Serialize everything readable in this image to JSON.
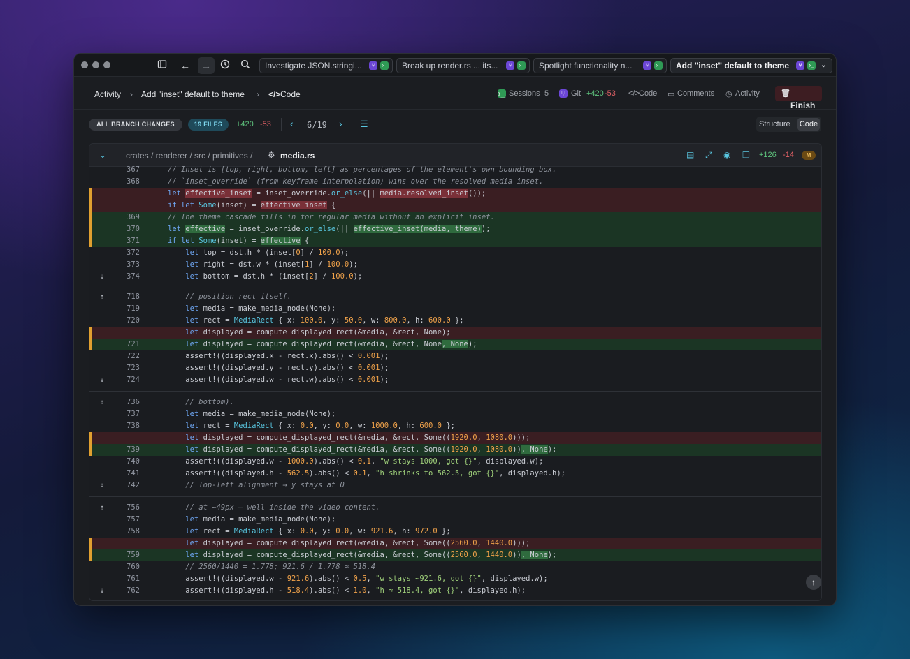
{
  "titlebar": {
    "tabs": [
      "Investigate JSON.stringi...",
      "Break up render.rs ... its...",
      "Spotlight functionality n...",
      "Add \"inset\" default to theme"
    ]
  },
  "header": {
    "crumb1": "Activity",
    "crumb2": "Add \"inset\" default to theme",
    "crumb3": "Code",
    "sessions_label": "Sessions",
    "sessions_count": "5",
    "git_label": "Git",
    "git_add": "+420",
    "git_del": "-53",
    "code_label": "Code",
    "comments_label": "Comments",
    "activity_label": "Activity",
    "finish_label": "Finish"
  },
  "changes": {
    "all_label": "ALL BRANCH CHANGES",
    "files_label": "19 FILES",
    "add": "+420",
    "del": "-53",
    "pager": "6/19",
    "structure_label": "Structure",
    "code_label": "Code"
  },
  "file": {
    "path": "crates / renderer / src / primitives /",
    "name": "media.rs",
    "add": "+126",
    "del": "-14",
    "status": "M"
  },
  "colors": {
    "accent_add": "#2f9a55",
    "accent_del": "#e05a60",
    "gutter_marker": "#e0a030"
  }
}
